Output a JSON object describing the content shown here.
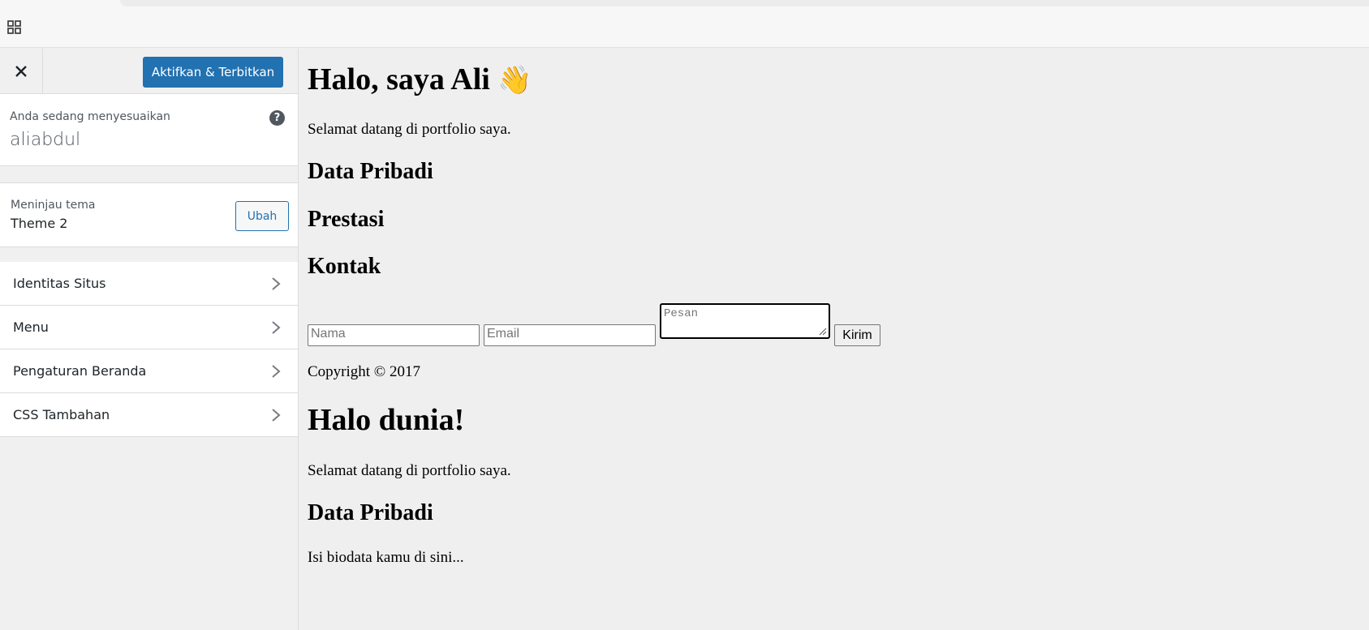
{
  "customizer": {
    "publish_label": "Aktifkan & Terbitkan",
    "customizing_label": "Anda sedang menyesuaikan",
    "site_name": "aliabdul",
    "help_glyph": "?",
    "theme_label": "Meninjau tema",
    "theme_name": "Theme 2",
    "change_label": "Ubah",
    "sections": [
      {
        "label": "Identitas Situs"
      },
      {
        "label": "Menu"
      },
      {
        "label": "Pengaturan Beranda"
      },
      {
        "label": "CSS Tambahan"
      }
    ]
  },
  "preview": {
    "hero_title": "Halo, saya Ali",
    "hero_emoji": "👋",
    "welcome": "Selamat datang di portfolio saya.",
    "h_data_pribadi": "Data Pribadi",
    "h_prestasi": "Prestasi",
    "h_kontak": "Kontak",
    "form": {
      "name_placeholder": "Nama",
      "email_placeholder": "Email",
      "message_placeholder": "Pesan",
      "submit_label": "Kirim"
    },
    "copyright": "Copyright © 2017",
    "post_title": "Halo dunia!",
    "post_welcome": "Selamat datang di portfolio saya.",
    "post_h_data_pribadi": "Data Pribadi",
    "post_bio": "Isi biodata kamu di sini..."
  },
  "colors": {
    "accent": "#2271b1",
    "sidebar_bg": "#f0f0f1",
    "preview_bg": "#efefef"
  }
}
